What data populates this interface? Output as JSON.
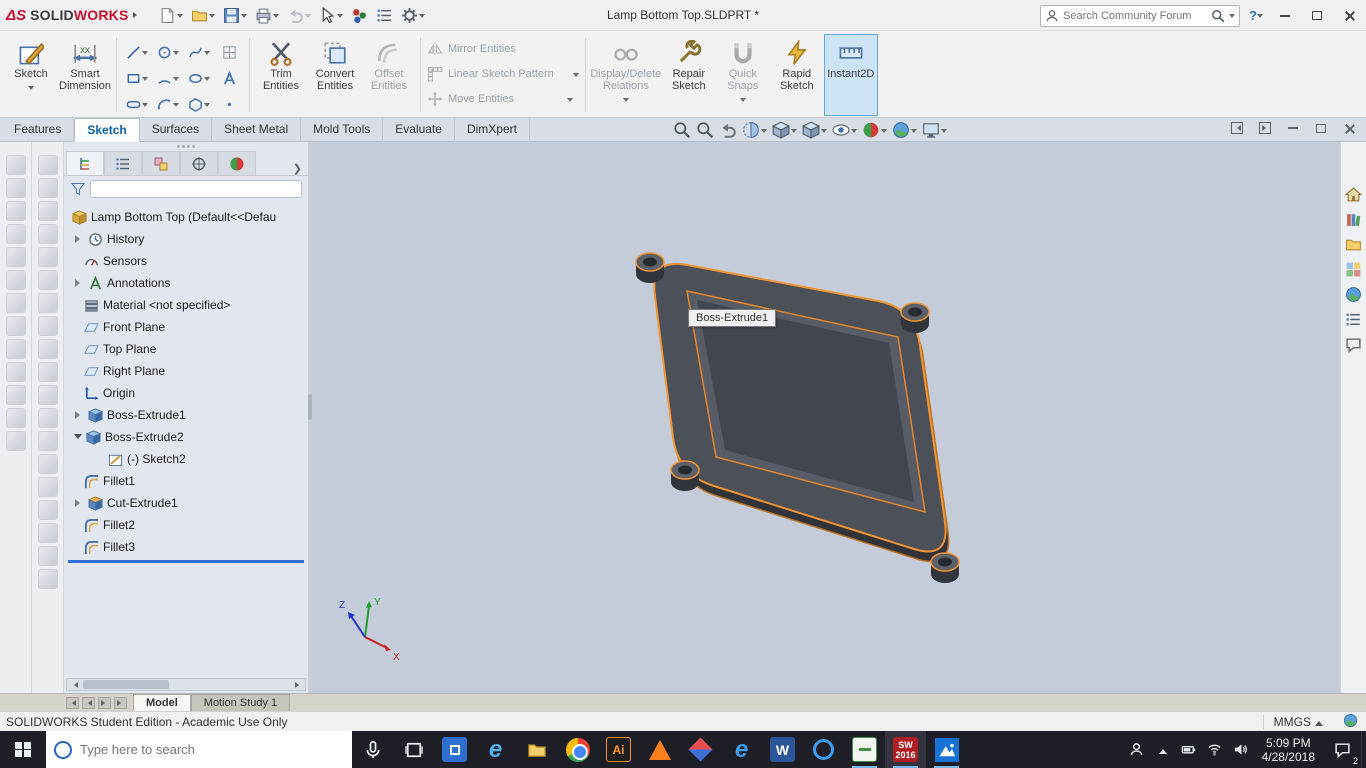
{
  "titlebar": {
    "logo_mark": "ΔS",
    "logo_solid": "SOLID",
    "logo_works": "WORKS",
    "document_title": "Lamp Bottom Top.SLDPRT *",
    "search_placeholder": "Search Community Forum",
    "help": "?",
    "icons": [
      "new-document",
      "open",
      "save",
      "print",
      "undo",
      "select",
      "appearance",
      "document-properties",
      "options"
    ]
  },
  "ribbon": {
    "sketch": "Sketch",
    "smart_dimension": "Smart Dimension",
    "trim_entities": "Trim Entities",
    "convert_entities": "Convert Entities",
    "offset_entities": "Offset Entities",
    "mirror_entities": "Mirror Entities",
    "linear_sketch_pattern": "Linear Sketch Pattern",
    "move_entities": "Move Entities",
    "display_delete_relations": "Display/Delete Relations",
    "repair_sketch": "Repair Sketch",
    "quick_snaps": "Quick Snaps",
    "rapid_sketch": "Rapid Sketch",
    "instant2d": "Instant2D",
    "entity_icons": [
      "line",
      "circle",
      "spline",
      "sketch-picture",
      "corner-rectangle",
      "arc",
      "ellipse",
      "text",
      "straight-slot",
      "3-point-arc",
      "polygon",
      "point"
    ]
  },
  "command_tabs": [
    {
      "label": "Features"
    },
    {
      "label": "Sketch"
    },
    {
      "label": "Surfaces"
    },
    {
      "label": "Sheet Metal"
    },
    {
      "label": "Mold Tools"
    },
    {
      "label": "Evaluate"
    },
    {
      "label": "DimXpert"
    }
  ],
  "active_command_tab": "Sketch",
  "headsup_icons": [
    "zoom-fit",
    "zoom-area",
    "previous-view",
    "section-view",
    "view-orientation",
    "display-style",
    "hide-show-items",
    "edit-appearance",
    "apply-scene",
    "view-settings"
  ],
  "feature_tree": {
    "panel_tabs": [
      "feature-manager-design-tree",
      "property-manager",
      "configuration-manager",
      "dimxpert-manager",
      "display-manager"
    ],
    "items": [
      {
        "label": "Lamp Bottom Top  (Default<<Defau",
        "icon": "part",
        "indent": 0
      },
      {
        "label": "History",
        "icon": "history",
        "indent": 1,
        "expand": "collapsed"
      },
      {
        "label": "Sensors",
        "icon": "sensors",
        "indent": 1
      },
      {
        "label": "Annotations",
        "icon": "annotations",
        "indent": 1,
        "expand": "collapsed"
      },
      {
        "label": "Material <not specified>",
        "icon": "material",
        "indent": 1
      },
      {
        "label": "Front Plane",
        "icon": "plane",
        "indent": 1
      },
      {
        "label": "Top Plane",
        "icon": "plane",
        "indent": 1
      },
      {
        "label": "Right Plane",
        "icon": "plane",
        "indent": 1
      },
      {
        "label": "Origin",
        "icon": "origin",
        "indent": 1
      },
      {
        "label": "Boss-Extrude1",
        "icon": "boss-extrude",
        "indent": 1,
        "expand": "collapsed"
      },
      {
        "label": "Boss-Extrude2",
        "icon": "boss-extrude",
        "indent": 1,
        "expand": "expanded"
      },
      {
        "label": "(-) Sketch2",
        "icon": "sketch",
        "indent": 2
      },
      {
        "label": "Fillet1",
        "icon": "fillet",
        "indent": 1
      },
      {
        "label": "Cut-Extrude1",
        "icon": "cut-extrude",
        "indent": 1,
        "expand": "collapsed"
      },
      {
        "label": "Fillet2",
        "icon": "fillet",
        "indent": 1
      },
      {
        "label": "Fillet3",
        "icon": "fillet",
        "indent": 1
      }
    ]
  },
  "task_pane_icons": [
    "solidworks-resources",
    "design-library",
    "file-explorer",
    "view-palette",
    "appearances-scenes",
    "custom-properties",
    "forum"
  ],
  "viewport": {
    "tooltip": "Boss-Extrude1",
    "triad": {
      "x": "X",
      "y": "Y",
      "z": "Z"
    }
  },
  "dock_tabs": [
    {
      "label": "Model"
    },
    {
      "label": "Motion Study 1"
    }
  ],
  "active_dock_tab": "Model",
  "statusbar": {
    "message": "SOLIDWORKS Student Edition - Academic Use Only",
    "units": "MMGS"
  },
  "taskbar": {
    "search_placeholder": "Type here to search",
    "time": "5:09 PM",
    "date": "4/28/2018",
    "notification_count": "2",
    "glyphs": {
      "ie": "e",
      "edge": "e",
      "word": "W",
      "illustrator": "Ai",
      "solidworks": "SW",
      "solidworks_year": "2016"
    },
    "app_icons": [
      "start",
      "cortana-search",
      "microphone",
      "task-view",
      "blue-tile-app",
      "internet-explorer",
      "file-explorer",
      "chrome",
      "illustrator",
      "vlc",
      "diamond-app",
      "edge",
      "word",
      "blue-circle-app",
      "green-document-app",
      "solidworks",
      "photos"
    ],
    "tray_icons": [
      "people",
      "hidden-icons",
      "battery",
      "wifi",
      "volume",
      "clock",
      "action-center"
    ]
  },
  "colors": {
    "accent_orange": "#ef9333",
    "viewport_bg": "#c5ccd9",
    "part_gray": "#4c5059",
    "rollback_blue": "#2f6fd6",
    "taskbar_dark": "#1d1e26"
  }
}
